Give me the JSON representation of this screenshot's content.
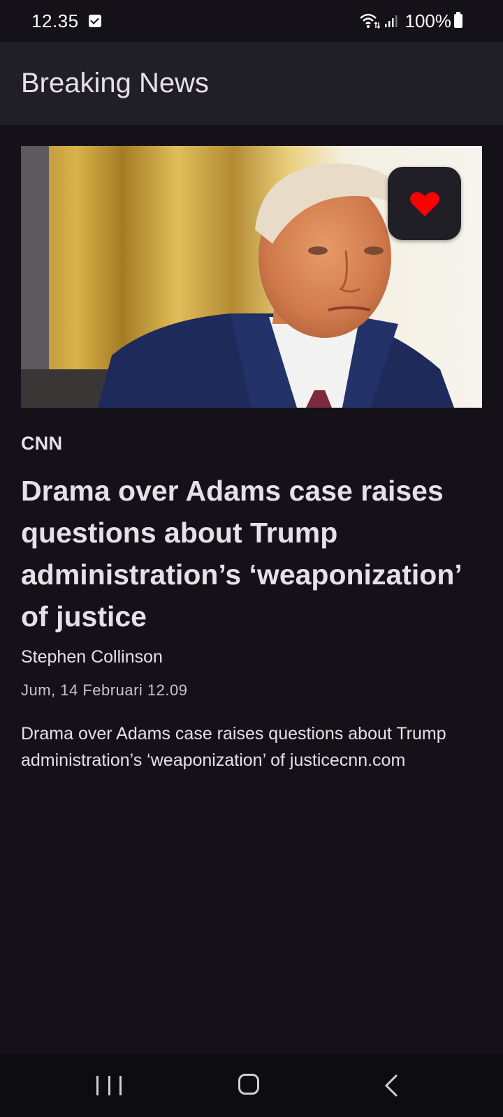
{
  "status_bar": {
    "time": "12.35",
    "battery": "100%",
    "icons": [
      "checkbox-notification-icon",
      "wifi-icon",
      "signal-icon",
      "battery-icon"
    ]
  },
  "app_bar": {
    "title": "Breaking News"
  },
  "article": {
    "image_alt": "Trump",
    "favorite_icon": "heart-icon",
    "favorite_color": "#FF0000",
    "source": "CNN",
    "headline": "Drama over Adams case raises questions about Trump administration’s ‘weaponization’ of justice",
    "author": "Stephen Collinson",
    "date": "Jum, 14 Februari 12.09",
    "description": "Drama over Adams case raises questions about Trump administration’s ‘weaponization’ of justicecnn.com"
  },
  "nav_bar": {
    "icons": [
      "recents-icon",
      "home-icon",
      "back-icon"
    ]
  },
  "colors": {
    "background": "#141218",
    "app_bar": "#211F26",
    "text": "#E6E0E9",
    "secondary_text": "#CAC4D0"
  }
}
